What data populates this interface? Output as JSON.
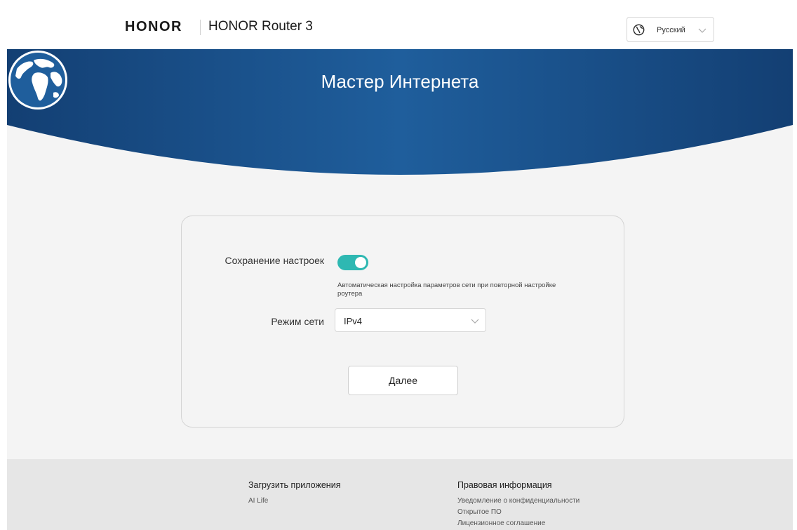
{
  "header": {
    "brand": "HONOR",
    "product": "HONOR Router 3",
    "language": "Русский",
    "globe_icon": "globe-icon",
    "chevron_icon": "chevron-down-icon"
  },
  "hero": {
    "title": "Мастер Интернета",
    "illustration": "earth-globe-icon"
  },
  "form": {
    "save_settings_label": "Сохранение настроек",
    "save_settings_on": true,
    "save_settings_hint": "Автоматическая настройка параметров сети при повторной настройке роутера",
    "network_mode_label": "Режим сети",
    "network_mode_value": "IPv4",
    "next_label": "Далее"
  },
  "footer": {
    "apps": {
      "title": "Загрузить приложения",
      "links": [
        "AI Life"
      ]
    },
    "legal": {
      "title": "Правовая информация",
      "links": [
        "Уведомление о конфиденциальности",
        "Открытое ПО",
        "Лицензионное соглашение"
      ]
    }
  },
  "colors": {
    "accent": "#2eb8b2",
    "hero_blue": "#1f5e9c",
    "hero_dark": "#133f73"
  }
}
